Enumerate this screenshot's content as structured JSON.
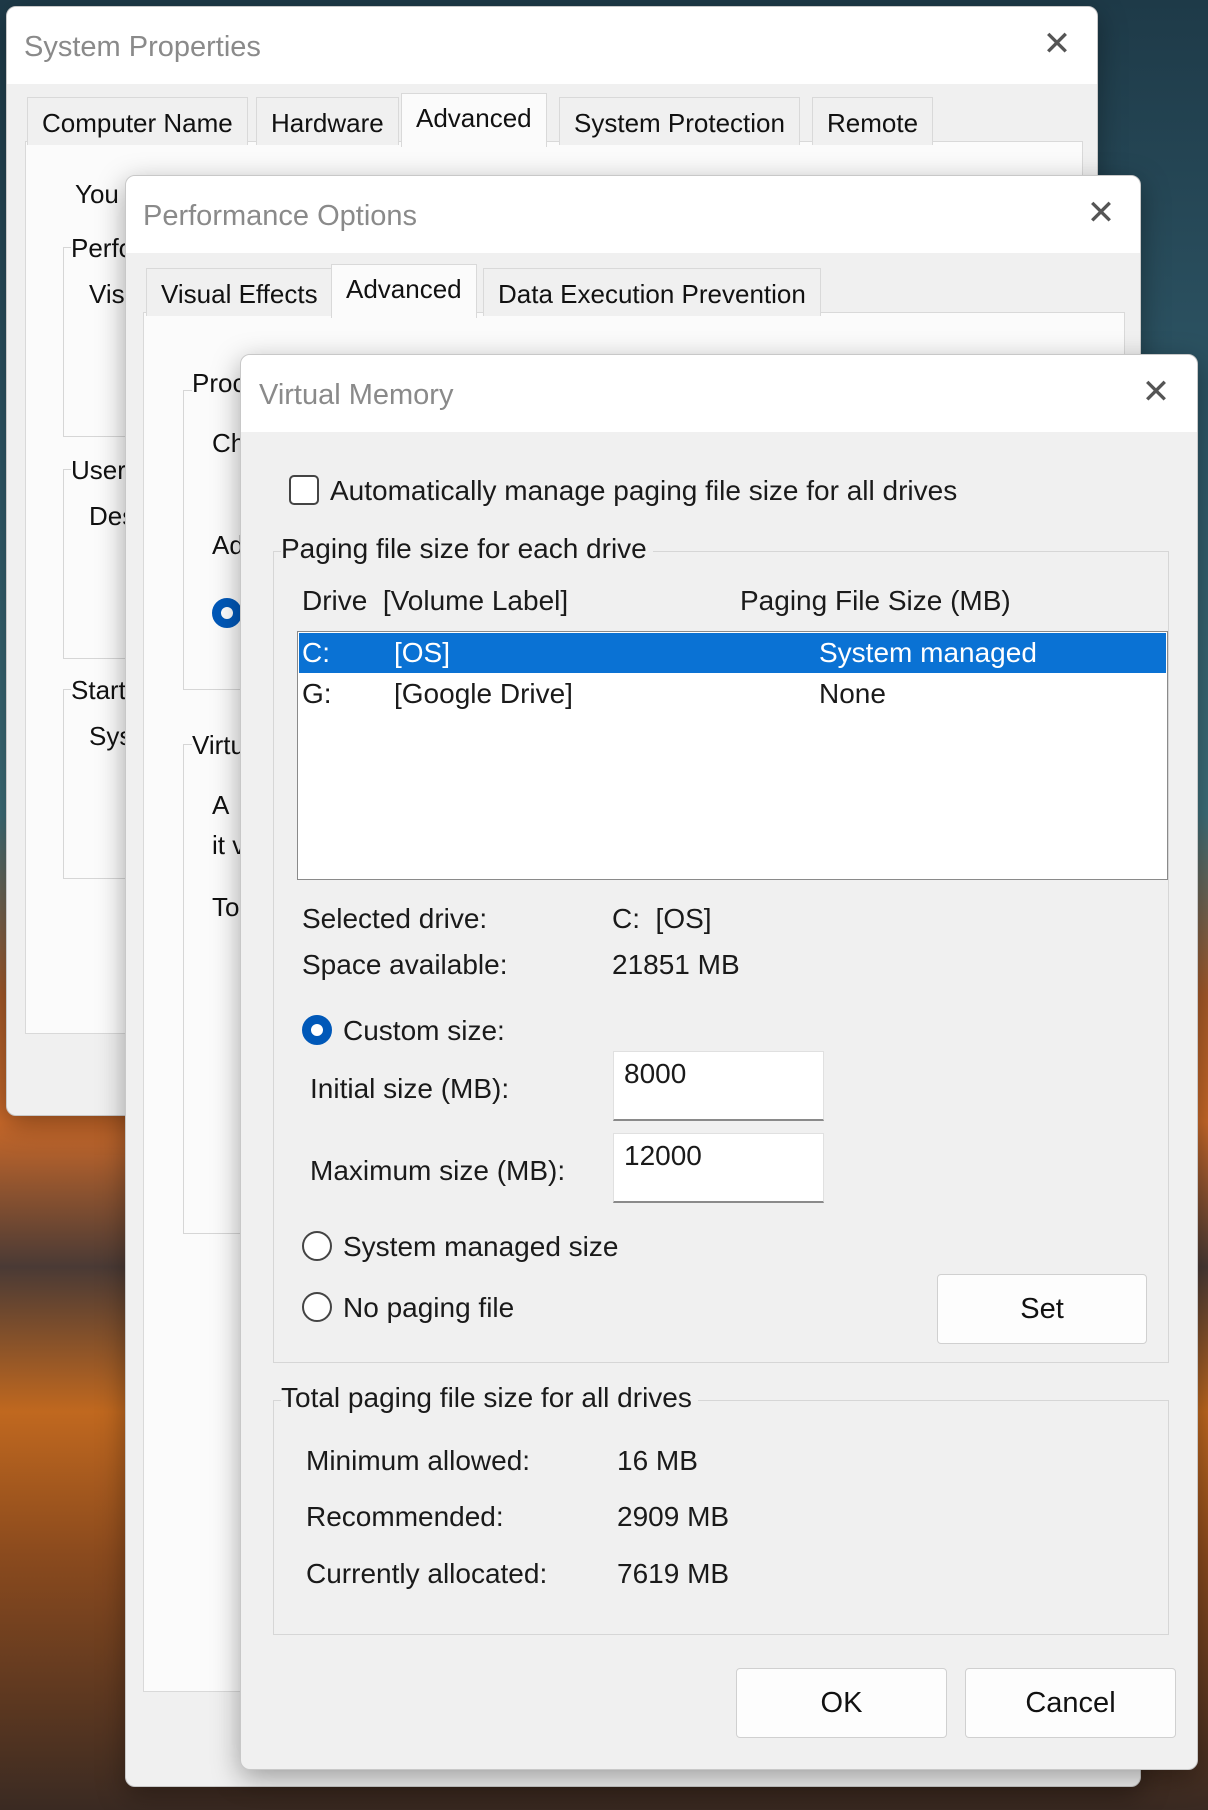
{
  "system_properties": {
    "title": "System Properties",
    "tabs": [
      "Computer Name",
      "Hardware",
      "Advanced",
      "System Protection",
      "Remote"
    ],
    "fragments": [
      "You",
      "Perfo",
      "Vis",
      "User",
      "Des",
      "Start",
      "Sys"
    ]
  },
  "performance_options": {
    "title": "Performance Options",
    "tabs": [
      "Visual Effects",
      "Advanced",
      "Data Execution Prevention"
    ],
    "fragments": [
      "Proc",
      "Ch",
      "Ad",
      "Virtu",
      "A",
      "it v",
      "To"
    ]
  },
  "virtual_memory": {
    "title": "Virtual Memory",
    "auto_manage_label": "Automatically manage paging file size for all drives",
    "auto_manage_checked": false,
    "paging_group_label": "Paging file size for each drive",
    "list_headers": {
      "drive": "Drive  [Volume Label]",
      "size": "Paging File Size (MB)"
    },
    "drives": [
      {
        "letter": "C:",
        "label": "[OS]",
        "size": "System managed",
        "selected": true
      },
      {
        "letter": "G:",
        "label": "[Google Drive]",
        "size": "None",
        "selected": false
      }
    ],
    "selected_drive_label": "Selected drive:",
    "selected_drive_value": "C:  [OS]",
    "space_available_label": "Space available:",
    "space_available_value": "21851 MB",
    "custom_size_label": "Custom size:",
    "initial_size_label": "Initial size (MB):",
    "initial_size_value": "8000",
    "maximum_size_label": "Maximum size (MB):",
    "maximum_size_value": "12000",
    "system_managed_label": "System managed size",
    "no_paging_label": "No paging file",
    "selected_option": "custom",
    "set_button": "Set",
    "total_group_label": "Total paging file size for all drives",
    "min_allowed_label": "Minimum allowed:",
    "min_allowed_value": "16 MB",
    "recommended_label": "Recommended:",
    "recommended_value": "2909 MB",
    "currently_allocated_label": "Currently allocated:",
    "currently_allocated_value": "7619 MB",
    "ok_button": "OK",
    "cancel_button": "Cancel"
  },
  "colors": {
    "accent": "#0a72d4",
    "radio_accent": "#0058b8",
    "dialog_bg": "#f0f0f0",
    "titlebar_bg": "#ffffff"
  }
}
